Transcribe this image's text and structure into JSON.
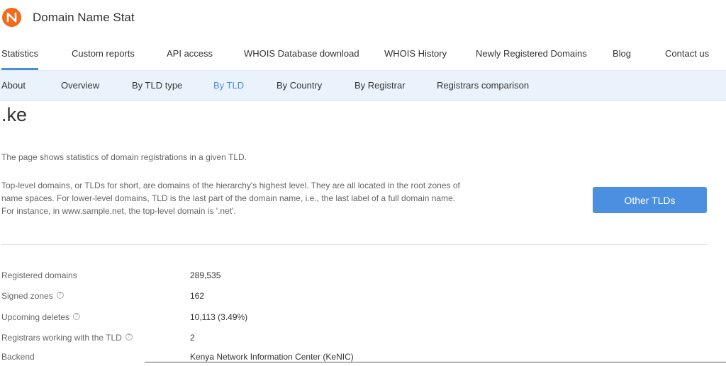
{
  "header": {
    "brand": "Domain Name Stat",
    "logo_icon": "domain-name-stat-logo",
    "logo_color": "#f26a1b"
  },
  "main_nav": {
    "items": [
      {
        "label": "Statistics",
        "active": true
      },
      {
        "label": "Custom reports"
      },
      {
        "label": "API access"
      },
      {
        "label": "WHOIS Database download"
      },
      {
        "label": "WHOIS History"
      },
      {
        "label": "Newly Registered Domains"
      },
      {
        "label": "Blog"
      },
      {
        "label": "Contact us"
      }
    ]
  },
  "sub_nav": {
    "items": [
      {
        "label": "About"
      },
      {
        "label": "Overview"
      },
      {
        "label": "By TLD type"
      },
      {
        "label": "By TLD",
        "active": true
      },
      {
        "label": "By Country"
      },
      {
        "label": "By Registrar"
      },
      {
        "label": "Registrars comparison"
      }
    ]
  },
  "page": {
    "title": ".ke",
    "intro": "The page shows statistics of domain registrations in a given TLD.",
    "description": [
      "Top-level domains, or TLDs for short, are domains of the hierarchy's highest level. They are all located in the root zones of",
      "name spaces. For lower-level domains, TLD is the last part of the domain name, i.e., the last label of a full domain name.",
      "For instance, in www.sample.net, the top-level domain is '.net'."
    ],
    "other_tlds_button": "Other TLDs"
  },
  "stats": [
    {
      "label": "Registered domains",
      "value": "289,535",
      "help": false
    },
    {
      "label": "Signed zones",
      "value": "162",
      "help": true
    },
    {
      "label": "Upcoming deletes",
      "value": "10,113 (3.49%)",
      "help": true
    },
    {
      "label": "Registrars working with the TLD",
      "value": "2",
      "help": true
    },
    {
      "label": "Backend",
      "value": "Kenya Network Information Center (KeNIC)",
      "help": false
    }
  ],
  "help_icon_text": "?",
  "colors": {
    "accent": "#4a90d9",
    "button": "#4a8fe0",
    "subnav_bg": "#eaf3fb"
  }
}
